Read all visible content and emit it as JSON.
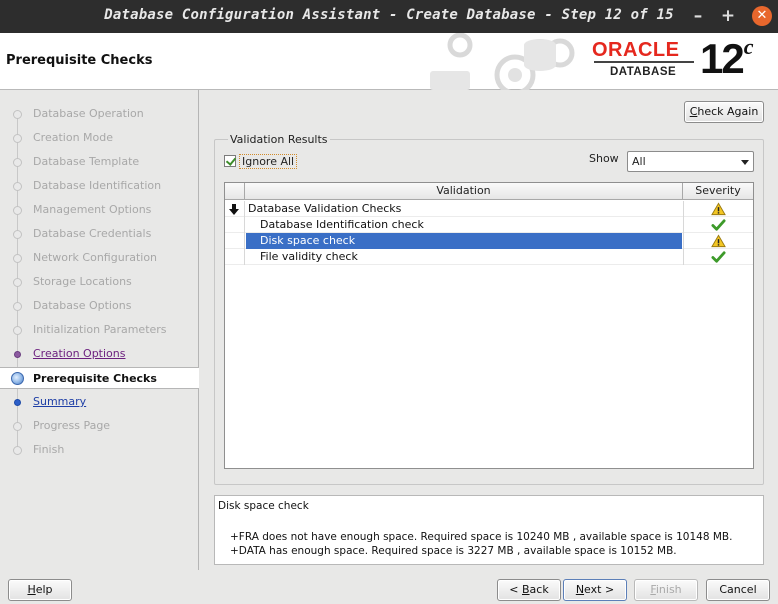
{
  "window": {
    "title": "Database Configuration Assistant - Create Database - Step 12 of 15",
    "minimize": "–",
    "maximize": "+",
    "close": "✕"
  },
  "header": {
    "page_title": "Prerequisite Checks",
    "logo_brand": "ORACLE",
    "logo_product": "DATABASE",
    "logo_version": "12",
    "logo_version_suffix": "c"
  },
  "nav": {
    "items": [
      {
        "label": "Database Operation",
        "state": "disabled"
      },
      {
        "label": "Creation Mode",
        "state": "disabled"
      },
      {
        "label": "Database Template",
        "state": "disabled"
      },
      {
        "label": "Database Identification",
        "state": "disabled"
      },
      {
        "label": "Management Options",
        "state": "disabled"
      },
      {
        "label": "Database Credentials",
        "state": "disabled"
      },
      {
        "label": "Network Configuration",
        "state": "disabled"
      },
      {
        "label": "Storage Locations",
        "state": "disabled"
      },
      {
        "label": "Database Options",
        "state": "disabled"
      },
      {
        "label": "Initialization Parameters",
        "state": "disabled"
      },
      {
        "label": "Creation Options",
        "state": "visited"
      },
      {
        "label": "Prerequisite Checks",
        "state": "current"
      },
      {
        "label": "Summary",
        "state": "link"
      },
      {
        "label": "Progress Page",
        "state": "disabled"
      },
      {
        "label": "Finish",
        "state": "disabled"
      }
    ]
  },
  "main": {
    "check_again": "Check Again",
    "group_title": "Validation Results",
    "ignore_all": {
      "label": "Ignore All",
      "checked": true
    },
    "show_label": "Show",
    "show_value": "All",
    "table": {
      "columns": [
        "Validation",
        "Severity"
      ],
      "rows": [
        {
          "label": "Database Validation Checks",
          "severity": "warning",
          "expanded": true,
          "selected": false
        },
        {
          "label": "Database Identification check",
          "severity": "ok",
          "selected": false
        },
        {
          "label": "Disk space check",
          "severity": "warning",
          "selected": true
        },
        {
          "label": "File validity check",
          "severity": "ok",
          "selected": false
        }
      ]
    },
    "details": {
      "title": "Disk space check",
      "line1": "+FRA does not have enough space. Required space is 10240 MB , available space is 10148 MB.",
      "line2": "+DATA has enough space. Required space is 3227 MB , available space is 10152 MB."
    }
  },
  "footer": {
    "help": "Help",
    "back": "< Back",
    "next": "Next >",
    "finish": "Finish",
    "cancel": "Cancel"
  },
  "colors": {
    "selection": "#3a6fc6",
    "oracle_red": "#e5281e",
    "ok_green": "#3d9a2a",
    "warning_yellow": "#f3c623"
  }
}
